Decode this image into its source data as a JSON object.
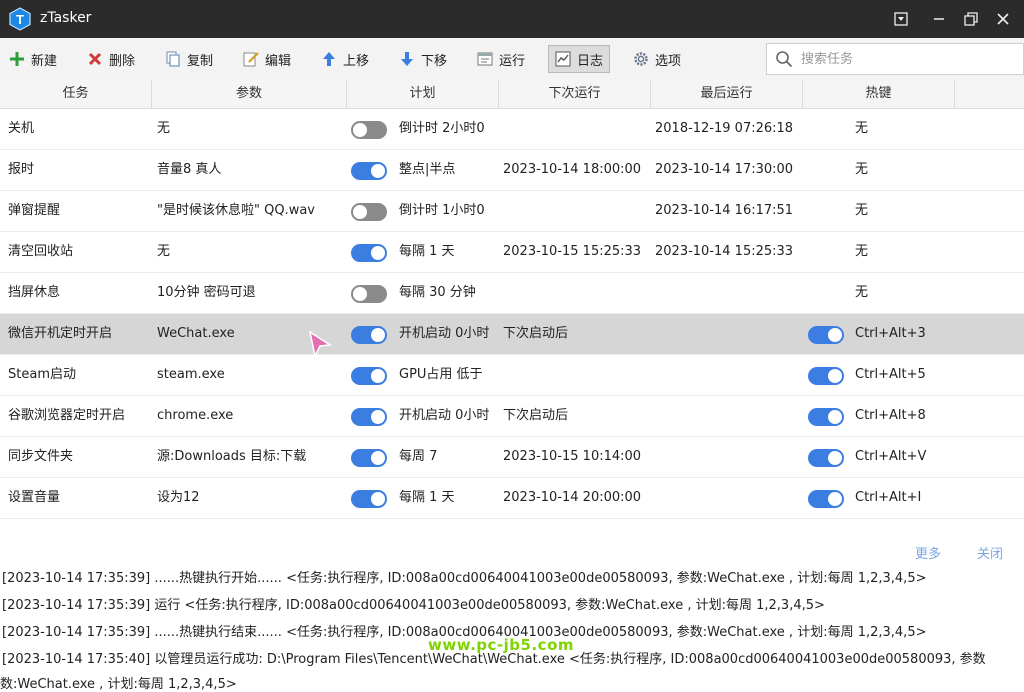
{
  "window": {
    "title": "zTasker",
    "logo_letter": "T"
  },
  "toolbar": {
    "buttons": [
      {
        "label": "新建",
        "icon": "plus-icon",
        "color": "#2e9e3a"
      },
      {
        "label": "删除",
        "icon": "x-icon",
        "color": "#d23a3a"
      },
      {
        "label": "复制",
        "icon": "copy-icon",
        "color": "#5a7fb5"
      },
      {
        "label": "编辑",
        "icon": "edit-icon",
        "color": "#6a6a6a"
      },
      {
        "label": "上移",
        "icon": "arrow-up-icon",
        "color": "#3b7de0"
      },
      {
        "label": "下移",
        "icon": "arrow-down-icon",
        "color": "#3b7de0"
      },
      {
        "label": "运行",
        "icon": "run-icon",
        "color": "#6a6a6a"
      },
      {
        "label": "日志",
        "icon": "log-icon",
        "color": "#6a6a6a"
      },
      {
        "label": "选项",
        "icon": "gear-icon",
        "color": "#6a6a6a"
      }
    ],
    "search_placeholder": "搜索任务"
  },
  "columns": [
    "任务",
    "参数",
    "计划",
    "下次运行",
    "最后运行",
    "热键"
  ],
  "rows": [
    {
      "task": "关机",
      "param": "无",
      "plan_on": false,
      "plan": "倒计时 2小时0",
      "next": "",
      "last": "2018-12-19 07:26:18",
      "hotkey_on": null,
      "hotkey": "无"
    },
    {
      "task": "报时",
      "param": "音量8 真人",
      "plan_on": true,
      "plan": "整点|半点",
      "next": "2023-10-14 18:00:00",
      "last": "2023-10-14 17:30:00",
      "hotkey_on": null,
      "hotkey": "无"
    },
    {
      "task": "弹窗提醒",
      "param": "\"是时候该休息啦\" QQ.wav",
      "plan_on": false,
      "plan": "倒计时 1小时0",
      "next": "",
      "last": "2023-10-14 16:17:51",
      "hotkey_on": null,
      "hotkey": "无"
    },
    {
      "task": "清空回收站",
      "param": "无",
      "plan_on": true,
      "plan": "每隔 1 天",
      "next": "2023-10-15 15:25:33",
      "last": "2023-10-14 15:25:33",
      "hotkey_on": null,
      "hotkey": "无"
    },
    {
      "task": "挡屏休息",
      "param": "10分钟 密码可退",
      "plan_on": false,
      "plan": "每隔 30 分钟",
      "next": "",
      "last": "",
      "hotkey_on": null,
      "hotkey": "无"
    },
    {
      "task": "微信开机定时开启",
      "param": "WeChat.exe",
      "plan_on": true,
      "plan": "开机启动 0小时",
      "next": "下次启动后",
      "last": "",
      "hotkey_on": true,
      "hotkey": "Ctrl+Alt+3"
    },
    {
      "task": "Steam启动",
      "param": "steam.exe",
      "plan_on": true,
      "plan": "GPU占用 低于",
      "next": "",
      "last": "",
      "hotkey_on": true,
      "hotkey": "Ctrl+Alt+5"
    },
    {
      "task": "谷歌浏览器定时开启",
      "param": "chrome.exe",
      "plan_on": true,
      "plan": "开机启动 0小时",
      "next": "下次启动后",
      "last": "",
      "hotkey_on": true,
      "hotkey": "Ctrl+Alt+8"
    },
    {
      "task": "同步文件夹",
      "param": "源:Downloads 目标:下载",
      "plan_on": true,
      "plan": "每周 7",
      "next": "2023-10-15 10:14:00",
      "last": "",
      "hotkey_on": true,
      "hotkey": "Ctrl+Alt+V"
    },
    {
      "task": "设置音量",
      "param": "设为12",
      "plan_on": true,
      "plan": "每隔 1 天",
      "next": "2023-10-14 20:00:00",
      "last": "",
      "hotkey_on": true,
      "hotkey": "Ctrl+Alt+I"
    }
  ],
  "selected_row": 5,
  "log": {
    "more_label": "更多",
    "close_label": "关闭",
    "lines": [
      "[2023-10-14 17:35:39] ......热键执行开始...... <任务:执行程序, ID:008a00cd00640041003e00de00580093, 参数:WeChat.exe , 计划:每周 1,2,3,4,5>",
      "[2023-10-14 17:35:39] 运行 <任务:执行程序, ID:008a00cd00640041003e00de00580093, 参数:WeChat.exe , 计划:每周 1,2,3,4,5>",
      "[2023-10-14 17:35:39] ......热键执行结束...... <任务:执行程序, ID:008a00cd00640041003e00de00580093, 参数:WeChat.exe , 计划:每周 1,2,3,4,5>",
      "[2023-10-14 17:35:40] 以管理员运行成功: D:\\Program Files\\Tencent\\WeChat\\WeChat.exe <任务:执行程序, ID:008a00cd00640041003e00de00580093, 参数",
      "数:WeChat.exe , 计划:每周 1,2,3,4,5>"
    ],
    "watermark": "www.pc-jb5.com"
  },
  "colors": {
    "accent": "#3b7de0",
    "titlebar": "#2b2b2b",
    "selected_row": "#d6d6d6"
  }
}
